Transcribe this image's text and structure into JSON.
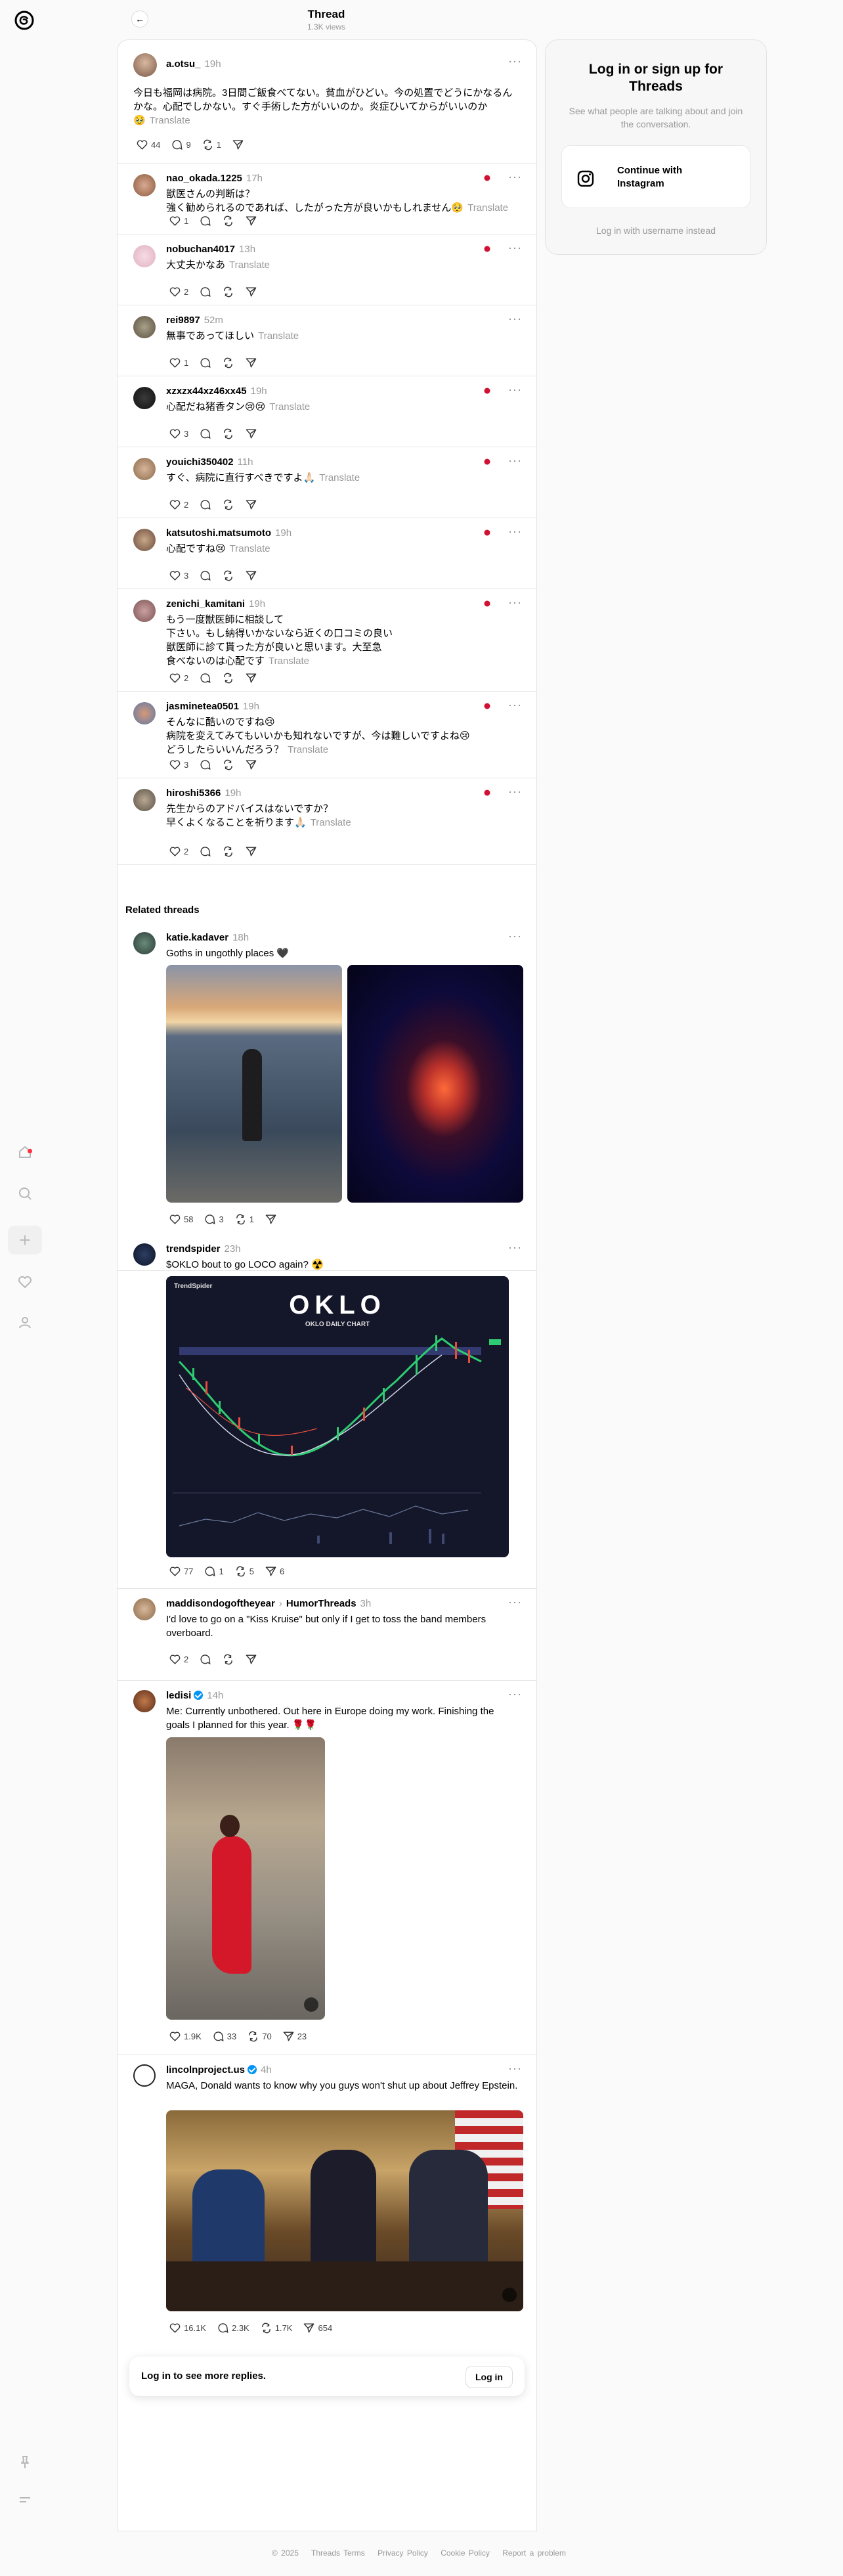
{
  "header": {
    "title": "Thread",
    "views": "1.3K views"
  },
  "sidebar": {
    "items": [
      "home-icon",
      "search-icon",
      "create-icon",
      "heart-icon",
      "profile-icon",
      "pin-icon",
      "menu-icon"
    ]
  },
  "main_post": {
    "user": "a.otsu_",
    "time": "19h",
    "text": "今日も福岡は病院。3日間ご飯食べてない。貧血がひどい。今の処置でどうにかなるんかな。心配でしかない。すぐ手術した方がいいのか。炎症ひいてからがいいのか",
    "text_tail": "🥹",
    "translate": "Translate",
    "likes": "44",
    "replies": "9",
    "reposts": "1"
  },
  "replies": [
    {
      "user": "nao_okada.1225",
      "time": "17h",
      "lines": [
        "獣医さんの判断は？",
        "強く勧められるのであれば、したがった方が良いかもしれません🥺"
      ],
      "translate": "Translate",
      "likes": "1",
      "replies": "",
      "reposts": "",
      "flag": true
    },
    {
      "user": "nobuchan4017",
      "time": "13h",
      "lines": [
        "大丈夫かなあ"
      ],
      "translate": "Translate",
      "likes": "2",
      "replies": "",
      "reposts": "",
      "flag": true
    },
    {
      "user": "rei9897",
      "time": "52m",
      "lines": [
        "無事であってほしい"
      ],
      "translate": "Translate",
      "likes": "1",
      "replies": "",
      "reposts": "",
      "flag": false
    },
    {
      "user": "xzxzx44xz46xx45",
      "time": "19h",
      "lines": [
        "心配だね猪香タン😢😢"
      ],
      "translate": "Translate",
      "likes": "3",
      "replies": "",
      "reposts": "",
      "flag": true
    },
    {
      "user": "youichi350402",
      "time": "11h",
      "lines": [
        "すぐ、病院に直行すべきですよ🙏🏻"
      ],
      "translate": "Translate",
      "likes": "2",
      "replies": "",
      "reposts": "",
      "flag": true
    },
    {
      "user": "katsutoshi.matsumoto",
      "time": "19h",
      "lines": [
        "心配ですね😢"
      ],
      "translate": "Translate",
      "likes": "3",
      "replies": "",
      "reposts": "",
      "flag": true
    },
    {
      "user": "zenichi_kamitani",
      "time": "19h",
      "lines": [
        "もう一度獣医師に相談して",
        "下さい。もし納得いかないなら近くの口コミの良い",
        "獣医師に診て貰った方が良いと思います。大至急",
        "食べないのは心配です"
      ],
      "translate": "Translate",
      "likes": "2",
      "replies": "",
      "reposts": "",
      "flag": true
    },
    {
      "user": "jasminetea0501",
      "time": "19h",
      "lines": [
        "そんなに酷いのですね😢",
        "病院を変えてみてもいいかも知れないですが、今は難しいですよね😢",
        "どうしたらいいんだろう？"
      ],
      "translate": "Translate",
      "likes": "3",
      "replies": "",
      "reposts": "",
      "flag": true
    },
    {
      "user": "hiroshi5366",
      "time": "19h",
      "lines": [
        "先生からのアドバイスはないですか？",
        "早くよくなることを祈ります🙏🏻"
      ],
      "translate": "Translate",
      "likes": "2",
      "replies": "",
      "reposts": "",
      "flag": true
    }
  ],
  "related_title": "Related threads",
  "related": [
    {
      "user": "katie.kadaver",
      "time": "18h",
      "text": "Goths in ungothly places 🖤",
      "likes": "58",
      "replies": "3",
      "reposts": "1",
      "shares": ""
    },
    {
      "user": "trendspider",
      "time": "23h",
      "text": "$OKLO bout to go LOCO again? ☢️",
      "likes": "77",
      "replies": "1",
      "reposts": "5",
      "shares": "6",
      "chart": {
        "brand": "TrendSpider",
        "title": "OKLO",
        "subtitle": "OKLO DAILY CHART"
      }
    },
    {
      "user": "maddisondogoftheyear",
      "via": "HumorThreads",
      "time": "3h",
      "text": "I'd love to go on a \"Kiss Kruise\" but only if I get to toss the band members overboard.",
      "likes": "2",
      "replies": "",
      "reposts": "",
      "shares": ""
    },
    {
      "user": "ledisi",
      "time": "14h",
      "verified": true,
      "text": "Me: Currently unbothered. Out here in Europe doing my work. Finishing the goals I planned for this year. 🌹🌹",
      "likes": "1.9K",
      "replies": "33",
      "reposts": "70",
      "shares": "23"
    },
    {
      "user": "lincolnproject.us",
      "time": "4h",
      "verified": true,
      "text": "MAGA, Donald wants to know why you guys won't shut up about Jeffrey Epstein.",
      "likes": "16.1K",
      "replies": "2.3K",
      "reposts": "1.7K",
      "shares": "654"
    }
  ],
  "login_bar": {
    "text": "Log in to see more replies.",
    "button": "Log in"
  },
  "login_card": {
    "title": "Log in or sign up for Threads",
    "subtitle": "See what people are talking about and join the conversation.",
    "ig_button": "Continue with Instagram",
    "alt": "Log in with username instead"
  },
  "footer": [
    "© 2025",
    "Threads Terms",
    "Privacy Policy",
    "Cookie Policy",
    "Report a problem"
  ],
  "colors": {
    "accent": "#0095f6",
    "notify": "#ff3040",
    "muted": "#999999"
  }
}
